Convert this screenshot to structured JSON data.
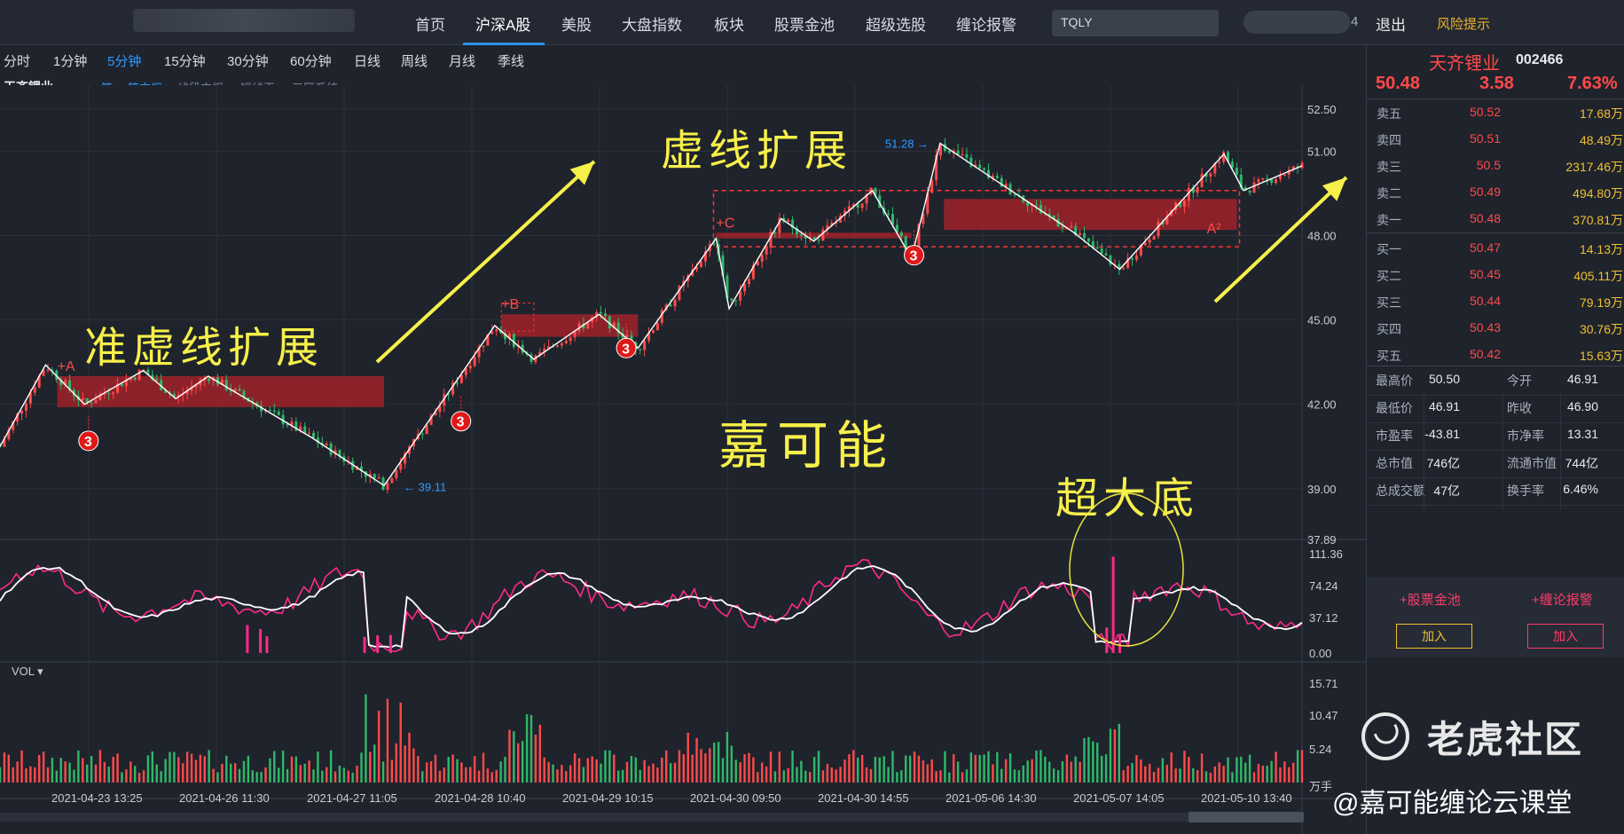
{
  "nav": {
    "items": [
      "首页",
      "沪深A股",
      "美股",
      "大盘指数",
      "板块",
      "股票金池",
      "超级选股",
      "缠论报警"
    ],
    "active": "沪深A股",
    "search_value": "TQLY",
    "user_suffix": "4",
    "logout": "退出",
    "risk": "风险提示"
  },
  "periods": {
    "items": [
      "分时",
      "1分钟",
      "5分钟",
      "15分钟",
      "30分钟",
      "60分钟",
      "日线",
      "周线",
      "月线",
      "季线"
    ],
    "active": "5分钟"
  },
  "subbar": {
    "stock": "天齐锂业",
    "options": [
      "笔",
      "笔中枢",
      "线段中枢",
      "短线王",
      "三区系统"
    ],
    "active": [
      "笔",
      "笔中枢"
    ]
  },
  "quote": {
    "name": "天齐锂业",
    "code": "002466",
    "price": "50.48",
    "change": "3.58",
    "change_pct": "7.63%"
  },
  "orderbook": {
    "asks": [
      {
        "label": "卖五",
        "price": "50.52",
        "vol": "17.68万"
      },
      {
        "label": "卖四",
        "price": "50.51",
        "vol": "48.49万"
      },
      {
        "label": "卖三",
        "price": "50.5",
        "vol": "2317.46万"
      },
      {
        "label": "卖二",
        "price": "50.49",
        "vol": "494.80万"
      },
      {
        "label": "卖一",
        "price": "50.48",
        "vol": "370.81万"
      }
    ],
    "bids": [
      {
        "label": "买一",
        "price": "50.47",
        "vol": "14.13万"
      },
      {
        "label": "买二",
        "price": "50.45",
        "vol": "405.11万"
      },
      {
        "label": "买三",
        "price": "50.44",
        "vol": "79.19万"
      },
      {
        "label": "买四",
        "price": "50.43",
        "vol": "30.76万"
      },
      {
        "label": "买五",
        "price": "50.42",
        "vol": "15.63万"
      }
    ]
  },
  "stats": [
    {
      "l1": "最高价",
      "v1": "50.50",
      "l2": "今开",
      "v2": "46.91"
    },
    {
      "l1": "最低价",
      "v1": "46.91",
      "l2": "昨收",
      "v2": "46.90"
    },
    {
      "l1": "市盈率",
      "v1": "-43.81",
      "l2": "市净率",
      "v2": "13.31"
    },
    {
      "l1": "总市值",
      "v1": "746亿",
      "l2": "流通市值",
      "v2": "744亿"
    },
    {
      "l1": "总成交额",
      "v1": "47亿",
      "l2": "换手率",
      "v2": "6.46%"
    }
  ],
  "actions": {
    "pool": "+股票金池",
    "alert": "+缠论报警",
    "add": "加入"
  },
  "colors": {
    "up": "#ff4a4a",
    "down": "#2fb86a",
    "accent": "#2f9bff",
    "annotation": "#f6f04a",
    "zone": "#a0212a",
    "kdj": "#ff2a8a"
  },
  "chart_data": {
    "type": "candlestick",
    "price_axis": [
      "52.50",
      "51.00",
      "48.00",
      "45.00",
      "42.00",
      "39.00",
      "37.89"
    ],
    "indicator_axis": [
      "111.36",
      "74.24",
      "37.12",
      "0.00"
    ],
    "volume_axis": [
      "15.71",
      "10.47",
      "5.24",
      "万手"
    ],
    "volume_label": "VOL",
    "x_labels": [
      "2021-04-23 13:25",
      "2021-04-26 11:30",
      "2021-04-27 11:05",
      "2021-04-28 10:40",
      "2021-04-29 10:15",
      "2021-04-30 09:50",
      "2021-04-30 14:55",
      "2021-05-06 14:30",
      "2021-05-07 14:05",
      "2021-05-10 13:40"
    ],
    "pivots": [
      {
        "t": 0.0,
        "p": 40.5
      },
      {
        "t": 0.035,
        "p": 43.4
      },
      {
        "t": 0.065,
        "p": 42.0
      },
      {
        "t": 0.11,
        "p": 43.2
      },
      {
        "t": 0.135,
        "p": 42.2
      },
      {
        "t": 0.16,
        "p": 43.0
      },
      {
        "t": 0.24,
        "p": 40.8
      },
      {
        "t": 0.295,
        "p": 39.11
      },
      {
        "t": 0.38,
        "p": 44.8
      },
      {
        "t": 0.41,
        "p": 43.6
      },
      {
        "t": 0.46,
        "p": 45.2
      },
      {
        "t": 0.49,
        "p": 44.0
      },
      {
        "t": 0.55,
        "p": 47.9
      },
      {
        "t": 0.56,
        "p": 45.4
      },
      {
        "t": 0.6,
        "p": 48.6
      },
      {
        "t": 0.625,
        "p": 47.8
      },
      {
        "t": 0.67,
        "p": 49.6
      },
      {
        "t": 0.7,
        "p": 47.2
      },
      {
        "t": 0.722,
        "p": 51.28
      },
      {
        "t": 0.825,
        "p": 48.1
      },
      {
        "t": 0.86,
        "p": 46.8
      },
      {
        "t": 0.94,
        "p": 50.9
      },
      {
        "t": 0.955,
        "p": 49.6
      },
      {
        "t": 1.0,
        "p": 50.48
      }
    ],
    "price_labels": [
      "39.11",
      "51.28"
    ],
    "zones": [
      {
        "t0": 0.044,
        "t1": 0.295,
        "lo": 41.9,
        "hi": 43.0,
        "label": "+A"
      },
      {
        "t0": 0.385,
        "t1": 0.49,
        "lo": 44.4,
        "hi": 45.2,
        "label": "+B"
      },
      {
        "t0": 0.55,
        "t1": 0.7,
        "lo": 47.9,
        "hi": 48.1,
        "label": "+C"
      },
      {
        "t0": 0.725,
        "t1": 0.95,
        "lo": 48.2,
        "hi": 49.3,
        "label": "A²"
      }
    ],
    "markers": [
      "3",
      "3",
      "3",
      "3"
    ]
  },
  "annotations": {
    "a1": "准虚线扩展",
    "a2": "虚线扩展",
    "a3": "嘉可能",
    "a4": "超大底"
  },
  "watermark": {
    "text": "老虎社区",
    "credit": "@嘉可能缠论云课堂"
  }
}
